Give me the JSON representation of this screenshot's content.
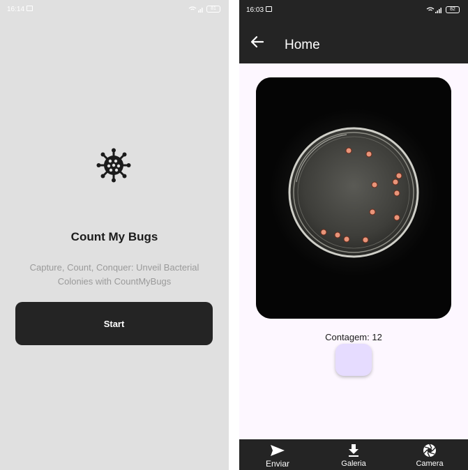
{
  "left_screen": {
    "status": {
      "time": "16:14",
      "battery": "81"
    },
    "title": "Count My Bugs",
    "subtitle": "Capture, Count, Conquer: Unveil Bacterial Colonies with CountMyBugs",
    "start_label": "Start",
    "icon": "bacteria-icon"
  },
  "right_screen": {
    "status": {
      "time": "16:03",
      "battery": "82"
    },
    "appbar": {
      "title": "Home",
      "back_icon": "arrow-left-icon"
    },
    "count_label": "Contagem: 12",
    "colony_count": 12,
    "fab_color": "#e6dcff",
    "bottom_nav": [
      {
        "label": "Enviar",
        "icon": "send-icon"
      },
      {
        "label": "Galeria",
        "icon": "download-icon"
      },
      {
        "label": "Camera",
        "icon": "camera-shutter-icon"
      }
    ]
  },
  "colors": {
    "dark": "#242424",
    "left_bg": "#e0e0e0",
    "right_bg": "#fdf7ff",
    "colony_marker": "#e8957a"
  }
}
